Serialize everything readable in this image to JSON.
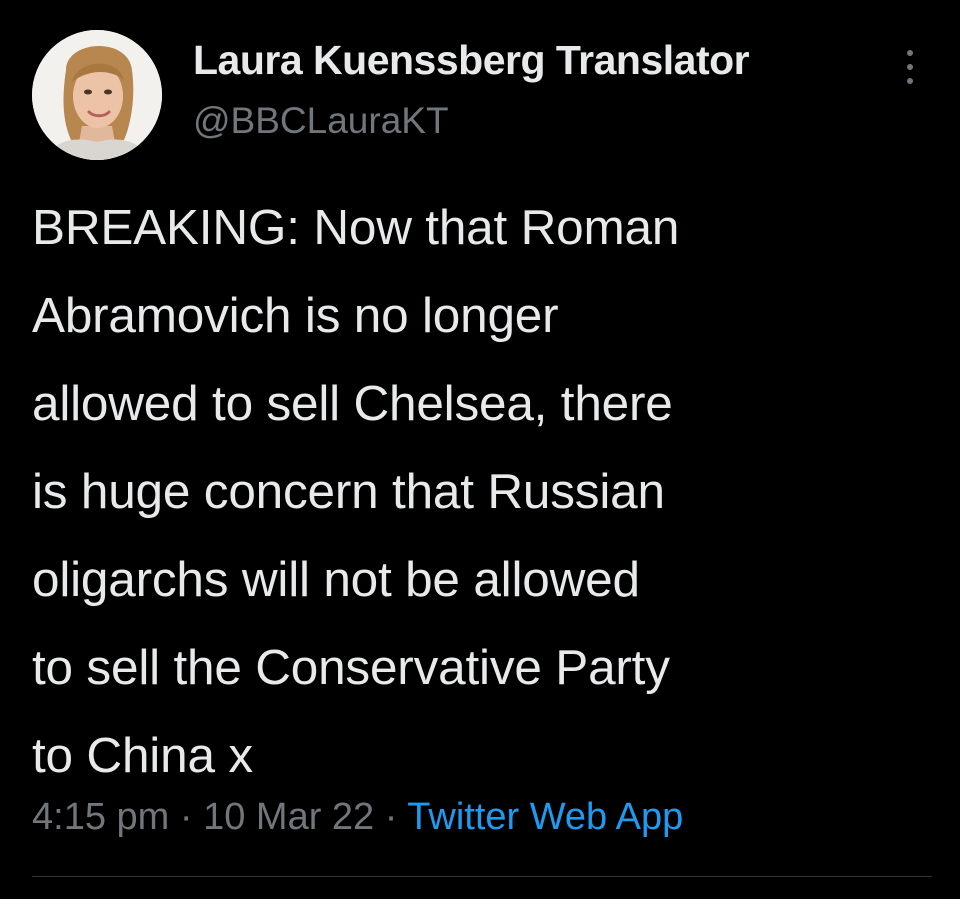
{
  "tweet": {
    "author": {
      "display_name": "Laura Kuenssberg Translator",
      "handle": "@BBCLauraKT",
      "avatar": "profile-photo"
    },
    "more_icon": "more-vertical-icon",
    "text_lines": [
      "BREAKING: Now that Roman",
      "Abramovich is no longer",
      "allowed to sell Chelsea, there",
      "is huge concern that Russian",
      "oligarchs will not be allowed",
      "to sell the Conservative Party",
      "to China x"
    ],
    "meta": {
      "time": "4:15 pm",
      "separator": "·",
      "date": "10 Mar 22",
      "source": "Twitter Web App"
    }
  },
  "colors": {
    "background": "#000000",
    "primary_text": "#e7e9ea",
    "secondary_text": "#71767b",
    "link": "#1d9bf0",
    "divider": "#2f3336"
  }
}
